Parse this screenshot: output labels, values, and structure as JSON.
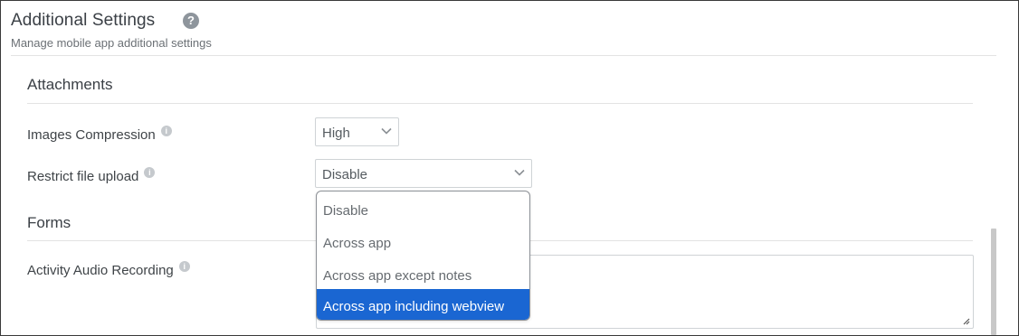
{
  "header": {
    "title": "Additional Settings",
    "subtitle": "Manage mobile app additional settings",
    "help_icon": "question-circle-icon"
  },
  "sections": {
    "attachments": {
      "title": "Attachments",
      "images_compression": {
        "label": "Images Compression",
        "value": "High"
      },
      "restrict_file_upload": {
        "label": "Restrict file upload",
        "value": "Disable",
        "options": [
          "Disable",
          "Across app",
          "Across app except notes",
          "Across app including webview"
        ],
        "highlighted_option": "Across app including webview"
      }
    },
    "forms": {
      "title": "Forms",
      "activity_audio_recording": {
        "label": "Activity Audio Recording",
        "value": ""
      }
    }
  },
  "colors": {
    "accent": "#1a66d2",
    "text": "#3f4448",
    "divider": "#e3e3e3",
    "border": "#cfd3d6"
  },
  "icons": {
    "info": "info-circle-icon",
    "chevron": "chevron-down-icon",
    "resize": "resize-handle-icon"
  }
}
